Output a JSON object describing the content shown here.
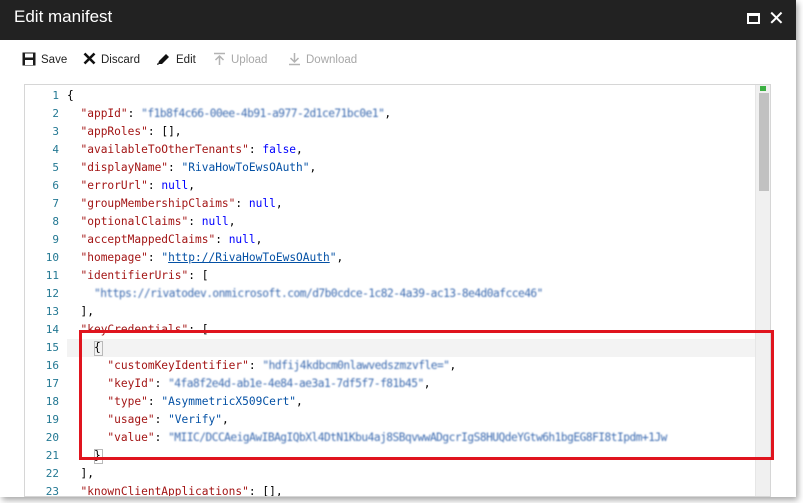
{
  "window": {
    "title": "Edit manifest",
    "maximize_icon": "maximize-icon",
    "close_glyph": "✕"
  },
  "toolbar": {
    "save": {
      "icon": "save-icon",
      "label": "Save"
    },
    "discard": {
      "icon": "close-icon",
      "label": "Discard"
    },
    "edit": {
      "icon": "pencil-icon",
      "label": "Edit"
    },
    "upload": {
      "icon": "upload-icon",
      "label": "Upload",
      "disabled": true
    },
    "download": {
      "icon": "download-icon",
      "label": "Download",
      "disabled": true
    }
  },
  "editor": {
    "line_numbers": [
      "1",
      "2",
      "3",
      "4",
      "5",
      "6",
      "7",
      "8",
      "9",
      "10",
      "11",
      "12",
      "13",
      "14",
      "15",
      "16",
      "17",
      "18",
      "19",
      "20",
      "21",
      "22",
      "23"
    ],
    "lines": {
      "l1": "{",
      "l2_key": "\"appId\"",
      "l2_val": "\"f1b8f4c66-00ee-4b91-a977-2d1ce71bc0e1\"",
      "l3_key": "\"appRoles\"",
      "l3_val": "[],",
      "l4_key": "\"availableToOtherTenants\"",
      "l4_val": "false",
      "l5_key": "\"displayName\"",
      "l5_val": "\"RivaHowToEwsOAuth\"",
      "l6_key": "\"errorUrl\"",
      "l6_val": "null",
      "l7_key": "\"groupMembershipClaims\"",
      "l7_val": "null",
      "l8_key": "\"optionalClaims\"",
      "l8_val": "null",
      "l9_key": "\"acceptMappedClaims\"",
      "l9_val": "null",
      "l10_key": "\"homepage\"",
      "l10_val": "http://RivaHowToEwsOAuth",
      "l11_key": "\"identifierUris\"",
      "l11_val": "[",
      "l12_val": "\"https://rivatodev.onmicrosoft.com/d7b0cdce-1c82-4a39-ac13-8e4d0afcce46\"",
      "l13": "],",
      "l14_key": "\"keyCredentials\"",
      "l14_val": "[",
      "l15": "{",
      "l16_key": "\"customKeyIdentifier\"",
      "l16_val": "\"hdfij4kdbcm0nlawvedszmzvfle=\"",
      "l17_key": "\"keyId\"",
      "l17_val": "\"4fa8f2e4d-ab1e-4e84-ae3a1-7df5f7-f81b45\"",
      "l18_key": "\"type\"",
      "l18_val": "\"AsymmetricX509Cert\"",
      "l19_key": "\"usage\"",
      "l19_val": "\"Verify\"",
      "l20_key": "\"value\"",
      "l20_val": "\"MIIC/DCCAeigAwIBAgIQbXl4DtN1Kbu4aj8SBqvwwADgcrIgS8HUQdeYGtw6h1bgEG8FI8tIpdm+1Jw",
      "l21": "}",
      "l22": "],",
      "l23_key": "\"knownClientApplications\"",
      "l23_val": "[],"
    }
  },
  "colors": {
    "titlebar": "#222222",
    "json_key": "#a31515",
    "json_string": "#0451a5",
    "json_keyword": "#0000ff",
    "line_number": "#237893",
    "highlight_box": "#e0141e"
  }
}
